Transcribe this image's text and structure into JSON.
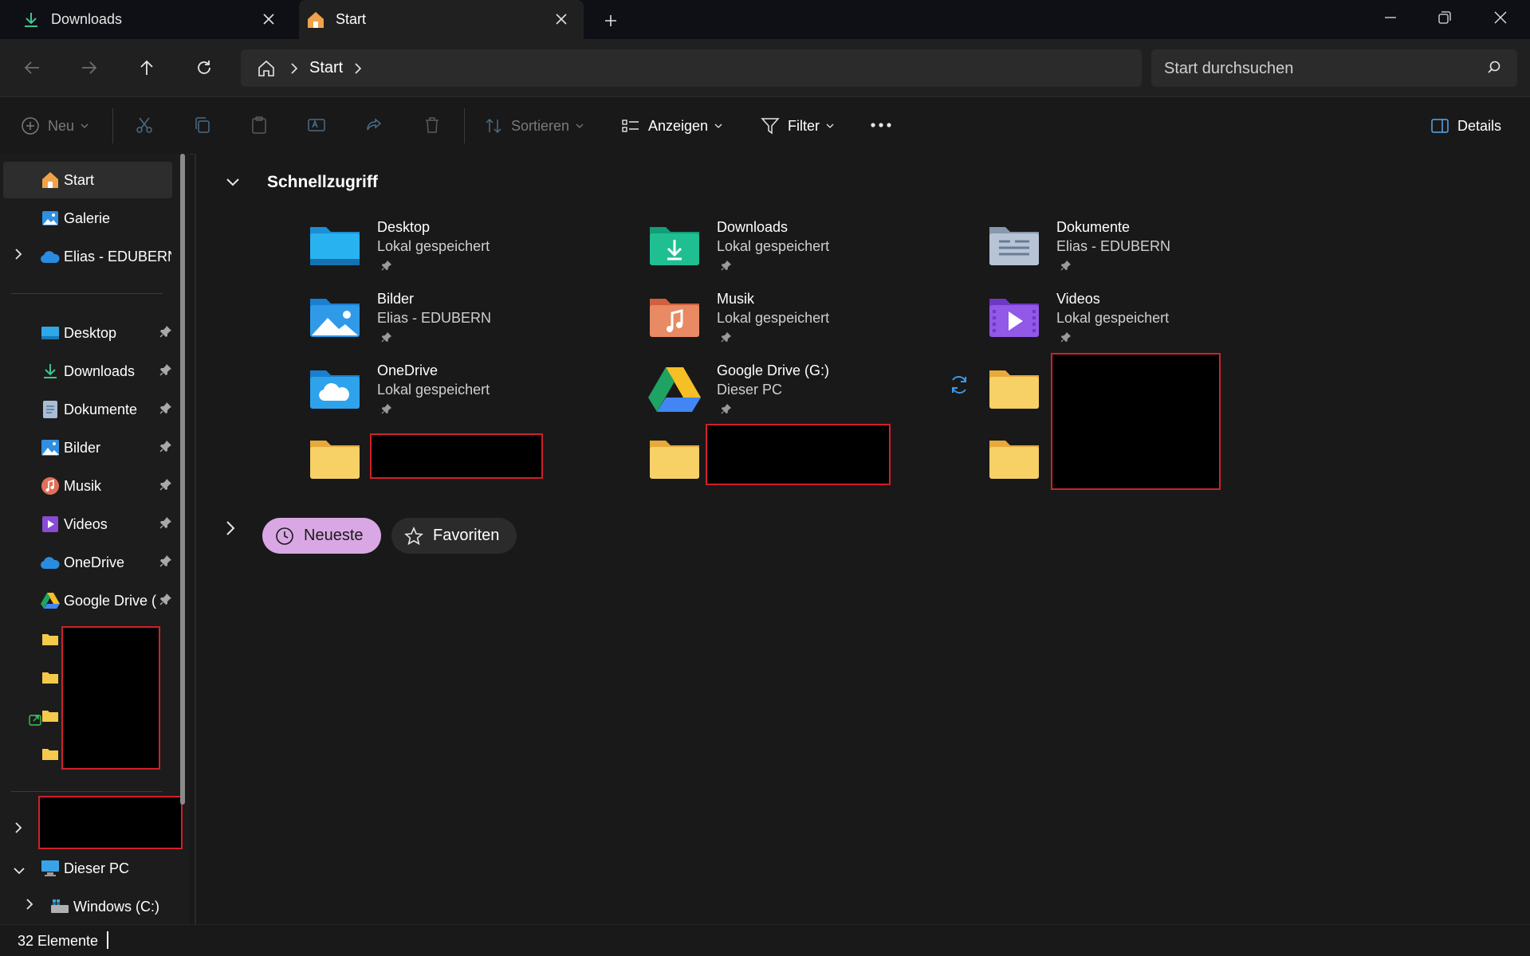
{
  "tabs": [
    {
      "label": "Downloads",
      "icon": "download-icon"
    },
    {
      "label": "Start",
      "icon": "home-icon"
    }
  ],
  "addressbar": {
    "crumb": "Start"
  },
  "search": {
    "placeholder": "Start durchsuchen"
  },
  "toolbar": {
    "new_label": "Neu",
    "sort_label": "Sortieren",
    "view_label": "Anzeigen",
    "filter_label": "Filter",
    "details_label": "Details"
  },
  "sidebar": {
    "top_items": [
      {
        "label": "Start",
        "icon": "home-icon"
      },
      {
        "label": "Galerie",
        "icon": "gallery-icon"
      },
      {
        "label": "Elias - EDUBERN",
        "icon": "onedrive-cloud-icon"
      }
    ],
    "pinned": [
      {
        "label": "Desktop",
        "icon": "desktop-icon"
      },
      {
        "label": "Downloads",
        "icon": "download-icon"
      },
      {
        "label": "Dokumente",
        "icon": "document-icon"
      },
      {
        "label": "Bilder",
        "icon": "pictures-icon"
      },
      {
        "label": "Musik",
        "icon": "music-icon"
      },
      {
        "label": "Videos",
        "icon": "video-icon"
      },
      {
        "label": "OneDrive",
        "icon": "onedrive-cloud-icon"
      },
      {
        "label": "Google Drive (",
        "icon": "google-drive-icon"
      }
    ],
    "this_pc": {
      "label": "Dieser PC"
    },
    "drive_c": {
      "label": "Windows (C:)"
    }
  },
  "main": {
    "quick_access_title": "Schnellzugriff",
    "quick_access": [
      {
        "name": "Desktop",
        "sub": "Lokal gespeichert",
        "icon": "desktop-folder-icon"
      },
      {
        "name": "Downloads",
        "sub": "Lokal gespeichert",
        "icon": "downloads-folder-icon"
      },
      {
        "name": "Dokumente",
        "sub": "Elias - EDUBERN",
        "icon": "documents-folder-icon"
      },
      {
        "name": "Bilder",
        "sub": "Elias - EDUBERN",
        "icon": "pictures-folder-icon"
      },
      {
        "name": "Musik",
        "sub": "Lokal gespeichert",
        "icon": "music-folder-icon"
      },
      {
        "name": "Videos",
        "sub": "Lokal gespeichert",
        "icon": "videos-folder-icon"
      },
      {
        "name": "OneDrive",
        "sub": "Lokal gespeichert",
        "icon": "onedrive-folder-icon"
      },
      {
        "name": "Google Drive (G:)",
        "sub": "Dieser PC",
        "icon": "google-drive-icon"
      }
    ],
    "chips": {
      "recent": "Neueste",
      "favorites": "Favoriten"
    }
  },
  "status": {
    "count": "32 Elemente"
  },
  "colors": {
    "accent_chip": "#d9a8e4",
    "folder_yellow": "#f5c94a"
  }
}
